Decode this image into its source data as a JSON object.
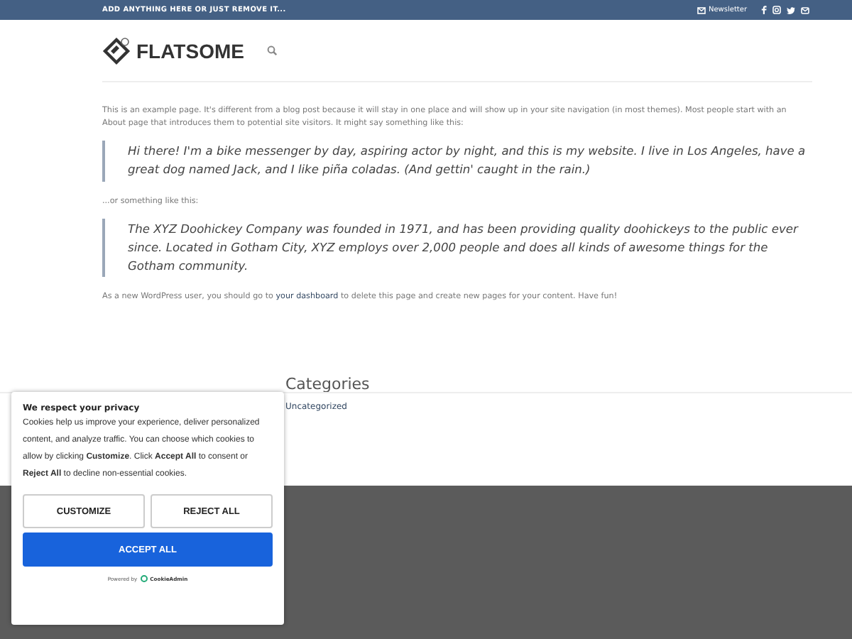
{
  "top_bar": {
    "message": "ADD ANYTHING HERE OR JUST REMOVE IT...",
    "newsletter": "Newsletter"
  },
  "header": {
    "logo": "FLATSOME"
  },
  "content": [
    {
      "kind": "paragraph",
      "text": "This is an example page. It's different from a blog post because it will stay in one place and will show up in your site navigation (in most themes). Most people start with an About page that introduces them to potential site visitors. It might say something like this:"
    },
    {
      "kind": "quote",
      "text": "Hi there! I'm a bike messenger by day, aspiring actor by night, and this is my website. I live in Los Angeles, have a great dog named Jack, and I like piña coladas. (And gettin' caught in the rain.)"
    },
    {
      "kind": "paragraph",
      "text": "...or something like this:"
    },
    {
      "kind": "quote",
      "text": "The XYZ Doohickey Company was founded in 1971, and has been providing quality doohickeys to the public ever since. Located in Gotham City, XYZ employs over 2,000 people and does all kinds of awesome things for the Gotham community."
    },
    {
      "kind": "paragraph",
      "text": "As a new WordPress user, you should go to ",
      "link": "your dashboard",
      "after": " to delete this page and create new pages for your content. Have fun!"
    }
  ],
  "widget": {
    "title": "Categories",
    "items": [
      "Uncategorized"
    ]
  },
  "cookie_banner": {
    "title": "We respect your privacy",
    "text": "Cookies help us improve your experience, deliver personalized content, and analyze traffic. You can choose which cookies to allow by clicking **Customize**. Click **Accept All** to consent or **Reject All** to decline non-essential cookies.",
    "buttons": [
      {
        "kind": "outline",
        "label": "CUSTOMIZE"
      },
      {
        "kind": "outline",
        "label": "REJECT ALL"
      },
      {
        "kind": "primary",
        "label": "ACCEPT ALL"
      }
    ],
    "powered_by": "Powered by",
    "brand": "CookieAdmin"
  }
}
